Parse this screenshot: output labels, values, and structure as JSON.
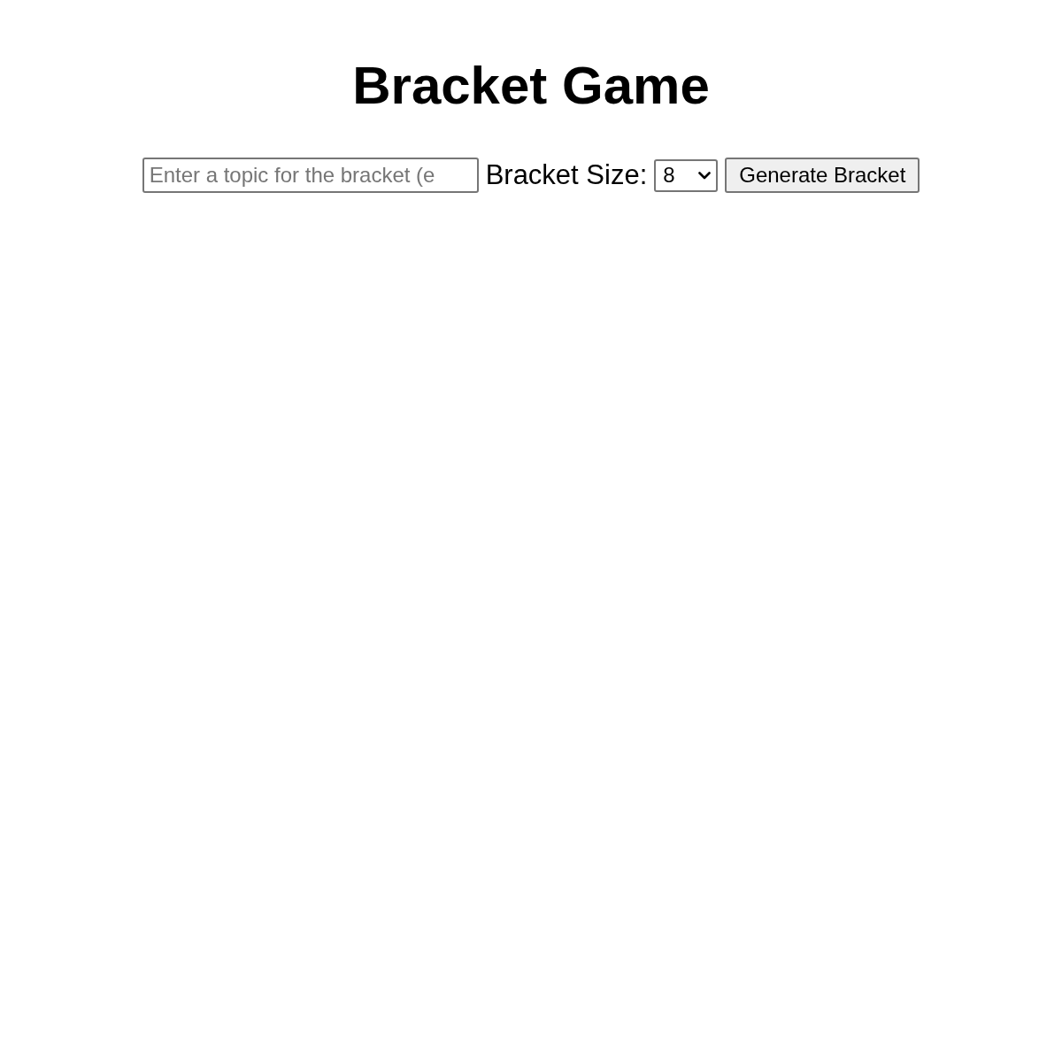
{
  "title": "Bracket Game",
  "controls": {
    "topic_field": {
      "placeholder": "Enter a topic for the bracket (e"
    },
    "size_label": "Bracket Size:",
    "size_select": {
      "value": "8"
    },
    "generate_button": "Generate Bracket"
  }
}
